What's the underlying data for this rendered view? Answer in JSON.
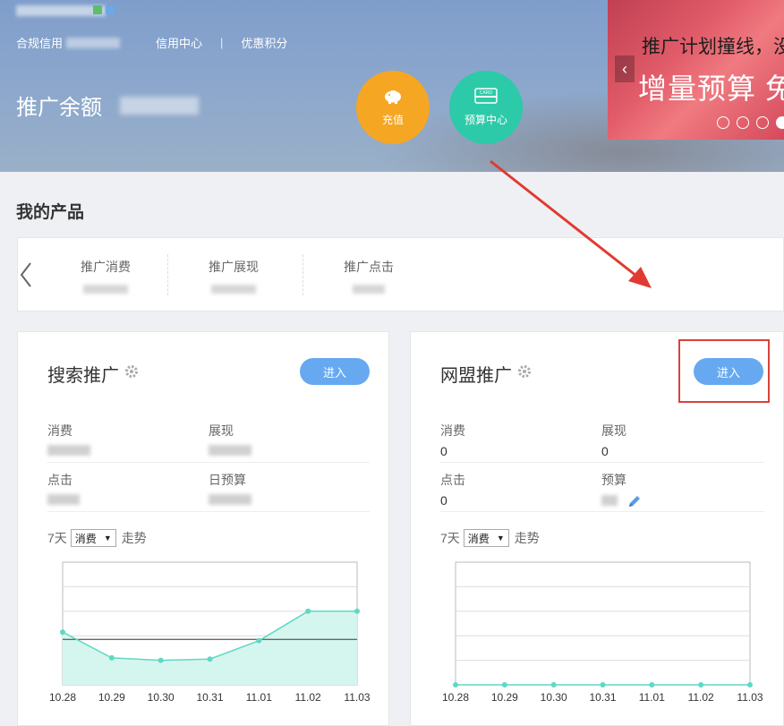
{
  "header": {
    "nav": {
      "compliance": "合规信用",
      "credit_center": "信用中心",
      "divider": "|",
      "coupons": "优惠积分"
    },
    "balance_label": "推广余额"
  },
  "actions": {
    "recharge": "充值",
    "budget_center": "预算中心",
    "card_icon_text": "CARD"
  },
  "banner": {
    "line1": "推广计划撞线，没",
    "line2": "增量预算 免",
    "prev_arrow": "‹"
  },
  "section_title": "我的产品",
  "stats": {
    "items": [
      {
        "label": "推广消费"
      },
      {
        "label": "推广展现"
      },
      {
        "label": "推广点击"
      }
    ]
  },
  "cards": {
    "search": {
      "title": "搜索推广",
      "enter": "进入",
      "metrics": {
        "spend": "消费",
        "impressions": "展现",
        "clicks": "点击",
        "daily_budget": "日预算"
      },
      "trend": {
        "days": "7天",
        "metric": "消费",
        "suffix": "走势"
      }
    },
    "union": {
      "title": "网盟推广",
      "enter": "进入",
      "metrics": {
        "spend": "消费",
        "spend_value": "0",
        "impressions": "展现",
        "impressions_value": "0",
        "clicks": "点击",
        "clicks_value": "0",
        "budget": "预算"
      },
      "trend": {
        "days": "7天",
        "metric": "消费",
        "suffix": "走势"
      }
    }
  },
  "chart_data": [
    {
      "type": "area",
      "categories": [
        "10.28",
        "10.29",
        "10.30",
        "10.31",
        "11.01",
        "11.02",
        "11.03"
      ],
      "series": [
        {
          "values": [
            0.43,
            0.22,
            0.2,
            0.21,
            0.36,
            0.6,
            0.6
          ]
        }
      ],
      "ylim": [
        0,
        1
      ],
      "grid": true,
      "colors": {
        "line": "#5fd8c4",
        "fill": "#d5f6ef",
        "reference": "#666666"
      },
      "reference_line": 0.37
    },
    {
      "type": "line",
      "categories": [
        "10.28",
        "10.29",
        "10.30",
        "10.31",
        "11.01",
        "11.02",
        "11.03"
      ],
      "series": [
        {
          "values": [
            0,
            0,
            0,
            0,
            0,
            0,
            0
          ]
        }
      ],
      "ylim": [
        0,
        1
      ],
      "grid": true,
      "colors": {
        "line": "#5fd8c4"
      }
    }
  ]
}
